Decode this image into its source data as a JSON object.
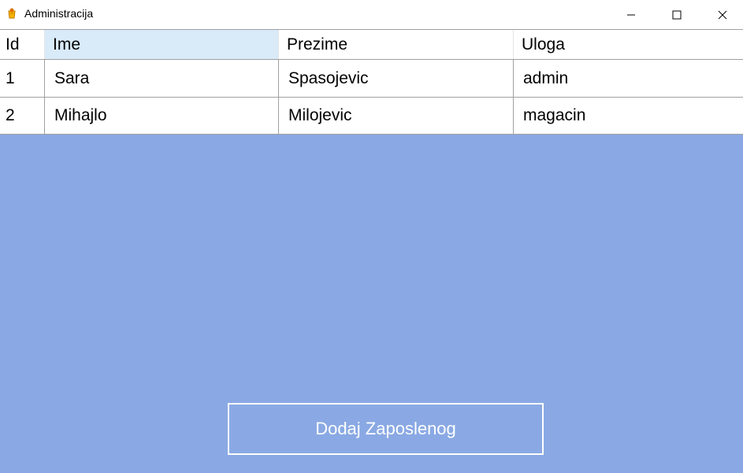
{
  "window": {
    "title": "Administracija",
    "icon": "app-icon",
    "controls": [
      "minimize-icon",
      "maximize-icon",
      "close-icon"
    ]
  },
  "grid": {
    "columns": [
      "Id",
      "Ime",
      "Prezime",
      "Uloga"
    ],
    "rows": [
      {
        "id": "1",
        "ime": "Sara",
        "prezime": "Spasojevic",
        "uloga": "admin"
      },
      {
        "id": "2",
        "ime": "Mihajlo",
        "prezime": "Milojevic",
        "uloga": "magacin"
      }
    ]
  },
  "actions": {
    "add_employee_label": "Dodaj Zaposlenog"
  },
  "colors": {
    "background": "#8aa9e4",
    "selected_header": "#d9eaf9",
    "button_border": "#ffffff"
  }
}
